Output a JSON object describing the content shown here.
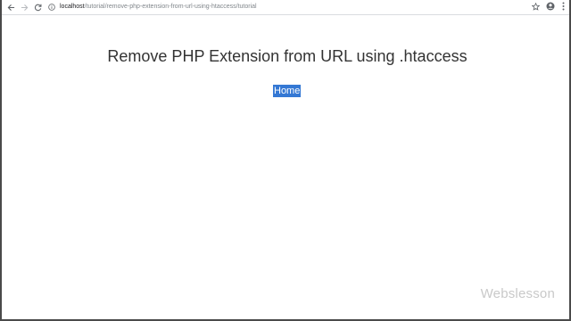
{
  "browser": {
    "url_host": "localhost",
    "url_path": "/tutorial/remove-php-extension-from-url-using-htaccess/tutorial",
    "icons": {
      "back": "arrow-left-icon",
      "forward": "arrow-right-icon",
      "reload": "reload-icon",
      "site_info": "info-icon",
      "bookmark": "star-icon",
      "account": "account-icon",
      "menu": "kebab-menu-icon"
    }
  },
  "page": {
    "title": "Remove PHP Extension from URL using .htaccess",
    "home_link": "Home",
    "home_link_bg": "#3478d4"
  },
  "watermark": "Webslesson"
}
